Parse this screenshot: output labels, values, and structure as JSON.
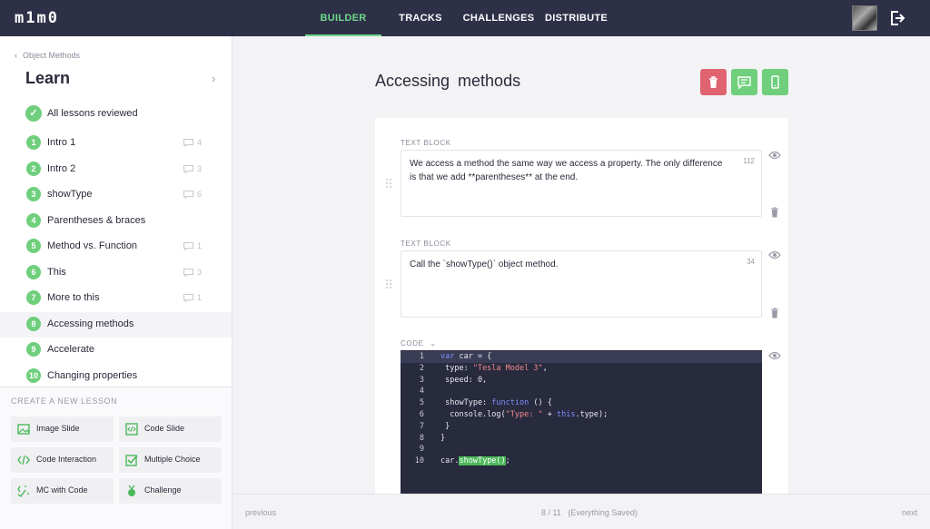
{
  "app": {
    "logo": "m1m0",
    "nav": [
      "BUILDER",
      "TRACKS",
      "CHALLENGES",
      "DISTRIBUTE"
    ],
    "active_tab": "BUILDER"
  },
  "sidebar": {
    "breadcrumb": "Object Methods",
    "section_title": "Learn",
    "reviewed_label": "All lessons reviewed",
    "lessons": [
      {
        "num": "1",
        "label": "Intro 1",
        "comments": "4"
      },
      {
        "num": "2",
        "label": "Intro 2",
        "comments": "3"
      },
      {
        "num": "3",
        "label": "showType",
        "comments": "6"
      },
      {
        "num": "4",
        "label": "Parentheses & braces",
        "comments": ""
      },
      {
        "num": "5",
        "label": "Method vs. Function",
        "comments": "1"
      },
      {
        "num": "6",
        "label": "This",
        "comments": "3"
      },
      {
        "num": "7",
        "label": "More to this",
        "comments": "1"
      },
      {
        "num": "8",
        "label": "Accessing methods",
        "comments": ""
      },
      {
        "num": "9",
        "label": "Accelerate",
        "comments": ""
      },
      {
        "num": "10",
        "label": "Changing properties",
        "comments": ""
      }
    ],
    "active_lesson": "8",
    "create_title": "CREATE A NEW LESSON",
    "create_buttons": [
      {
        "label": "Image Slide",
        "icon": "image-icon"
      },
      {
        "label": "Code Slide",
        "icon": "code-file-icon"
      },
      {
        "label": "Code Interaction",
        "icon": "code-brackets-icon"
      },
      {
        "label": "Multiple Choice",
        "icon": "checkbox-icon"
      },
      {
        "label": "MC with Code",
        "icon": "mc-code-icon"
      },
      {
        "label": "Challenge",
        "icon": "medal-icon"
      }
    ]
  },
  "main": {
    "title": "Accessing  methods",
    "colors": {
      "delete": "#e06370",
      "accent": "#6fcf7c"
    },
    "blocks": [
      {
        "label": "TEXT BLOCK",
        "text": "We access a method the same way we access a property. The only difference is that we add **parentheses** at the end.",
        "count": "112"
      },
      {
        "label": "TEXT BLOCK",
        "text": "Call the `showType()` object method.",
        "count": "34"
      }
    ],
    "code_label": "CODE",
    "code_lines": [
      {
        "n": "1",
        "t": "var car = {"
      },
      {
        "n": "2",
        "t": " type: \"Tesla Model 3\","
      },
      {
        "n": "3",
        "t": " speed: 0,"
      },
      {
        "n": "4",
        "t": ""
      },
      {
        "n": "5",
        "t": " showType: function () {"
      },
      {
        "n": "6",
        "t": "  console.log(\"Type: \" + this.type);"
      },
      {
        "n": "7",
        "t": " }"
      },
      {
        "n": "8",
        "t": "}"
      },
      {
        "n": "9",
        "t": ""
      },
      {
        "n": "10",
        "t": "car.showType();"
      }
    ]
  },
  "footer": {
    "previous": "previous",
    "status": "8 / 11   (Everything Saved)",
    "next": "next"
  }
}
